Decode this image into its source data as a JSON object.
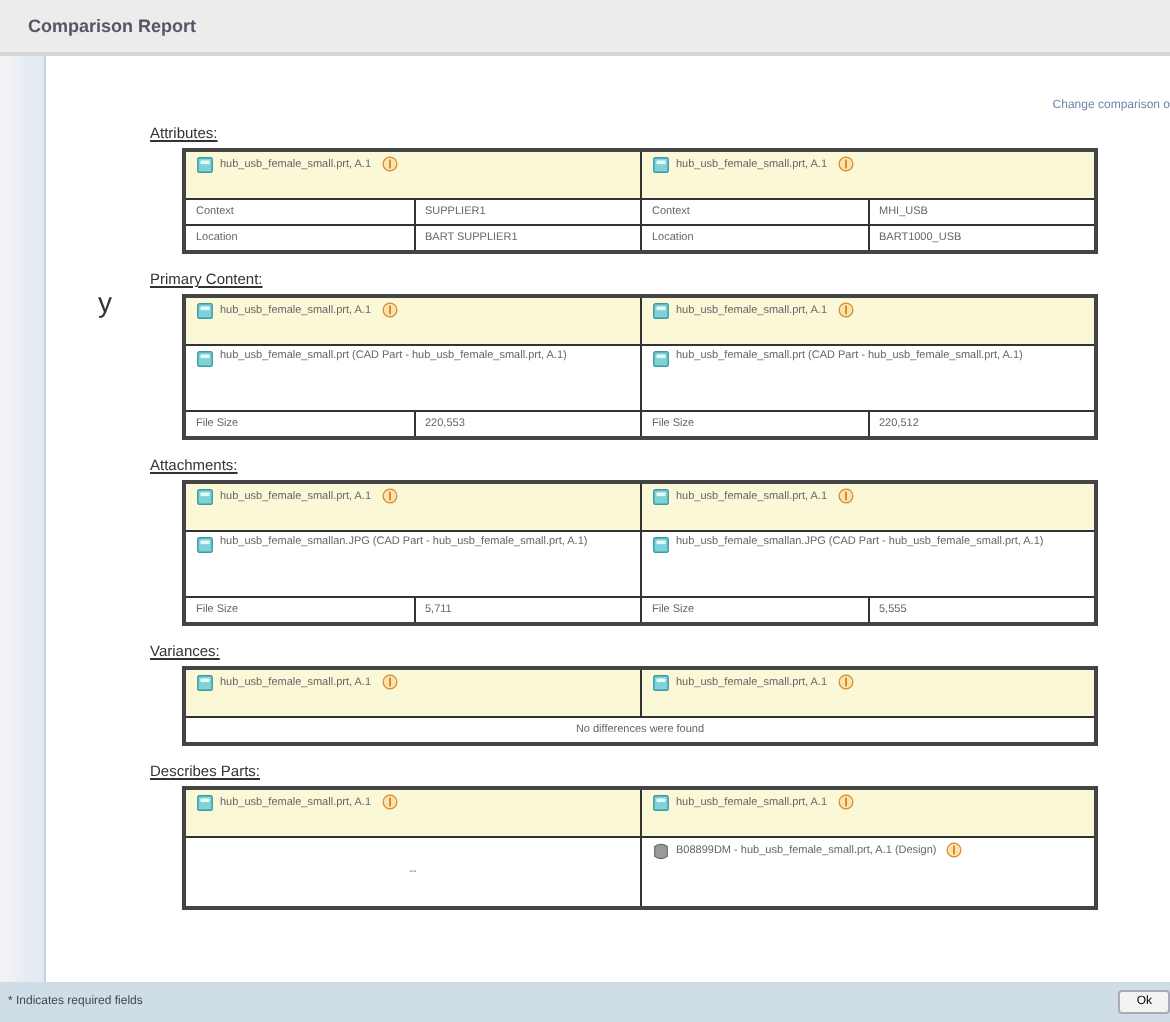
{
  "window": {
    "title": "Comparison Report"
  },
  "left_edge_text": "y",
  "change_link": "Change comparison o",
  "sections": [
    {
      "title": "Attributes:",
      "lines": [
        {
          "kind": "header",
          "left": {
            "text": "hub_usb_female_small.prt, A.1",
            "warning": true
          },
          "right": {
            "text": "hub_usb_female_small.prt, A.1",
            "warning": true
          }
        },
        {
          "kind": "field",
          "left": {
            "label": "Context",
            "value": "SUPPLIER1"
          },
          "right": {
            "label": "Context",
            "value": "MHI_USB"
          }
        },
        {
          "kind": "field",
          "left": {
            "label": "Location",
            "value": "BART SUPPLIER1"
          },
          "right": {
            "label": "Location",
            "value": "BART1000_USB"
          }
        }
      ]
    },
    {
      "title": "Primary Content:",
      "lines": [
        {
          "kind": "header",
          "left": {
            "text": "hub_usb_female_small.prt, A.1",
            "warning": true
          },
          "right": {
            "text": "hub_usb_female_small.prt, A.1",
            "warning": true
          }
        },
        {
          "kind": "document",
          "left": {
            "text": "hub_usb_female_small.prt (CAD Part - hub_usb_female_small.prt, A.1)"
          },
          "right": {
            "text": "hub_usb_female_small.prt (CAD Part - hub_usb_female_small.prt, A.1)"
          }
        },
        {
          "kind": "field",
          "left": {
            "label": "File Size",
            "value": "220,553"
          },
          "right": {
            "label": "File Size",
            "value": "220,512"
          }
        }
      ]
    },
    {
      "title": "Attachments:",
      "lines": [
        {
          "kind": "header",
          "left": {
            "text": "hub_usb_female_small.prt, A.1",
            "warning": true
          },
          "right": {
            "text": "hub_usb_female_small.prt, A.1",
            "warning": true
          }
        },
        {
          "kind": "document",
          "left": {
            "text": "hub_usb_female_smallan.JPG (CAD Part - hub_usb_female_small.prt, A.1)"
          },
          "right": {
            "text": "hub_usb_female_smallan.JPG (CAD Part - hub_usb_female_small.prt, A.1)"
          }
        },
        {
          "kind": "field",
          "left": {
            "label": "File Size",
            "value": "5,711"
          },
          "right": {
            "label": "File Size",
            "value": "5,555"
          }
        }
      ]
    },
    {
      "title": "Variances:",
      "lines": [
        {
          "kind": "header",
          "left": {
            "text": "hub_usb_female_small.prt, A.1",
            "warning": true
          },
          "right": {
            "text": "hub_usb_female_small.prt, A.1",
            "warning": true
          }
        },
        {
          "kind": "note",
          "text": "No differences were found"
        }
      ]
    },
    {
      "title": "Describes Parts:",
      "lines": [
        {
          "kind": "header",
          "left": {
            "text": "hub_usb_female_small.prt, A.1",
            "warning": true
          },
          "right": {
            "text": "hub_usb_female_small.prt, A.1",
            "warning": true
          }
        },
        {
          "kind": "part",
          "left": {
            "text": "--"
          },
          "right": {
            "text": "B08899DM - hub_usb_female_small.prt, A.1 (Design)",
            "warning": true
          }
        }
      ]
    }
  ],
  "footer": {
    "note": "* Indicates required fields",
    "button": "Ok"
  }
}
